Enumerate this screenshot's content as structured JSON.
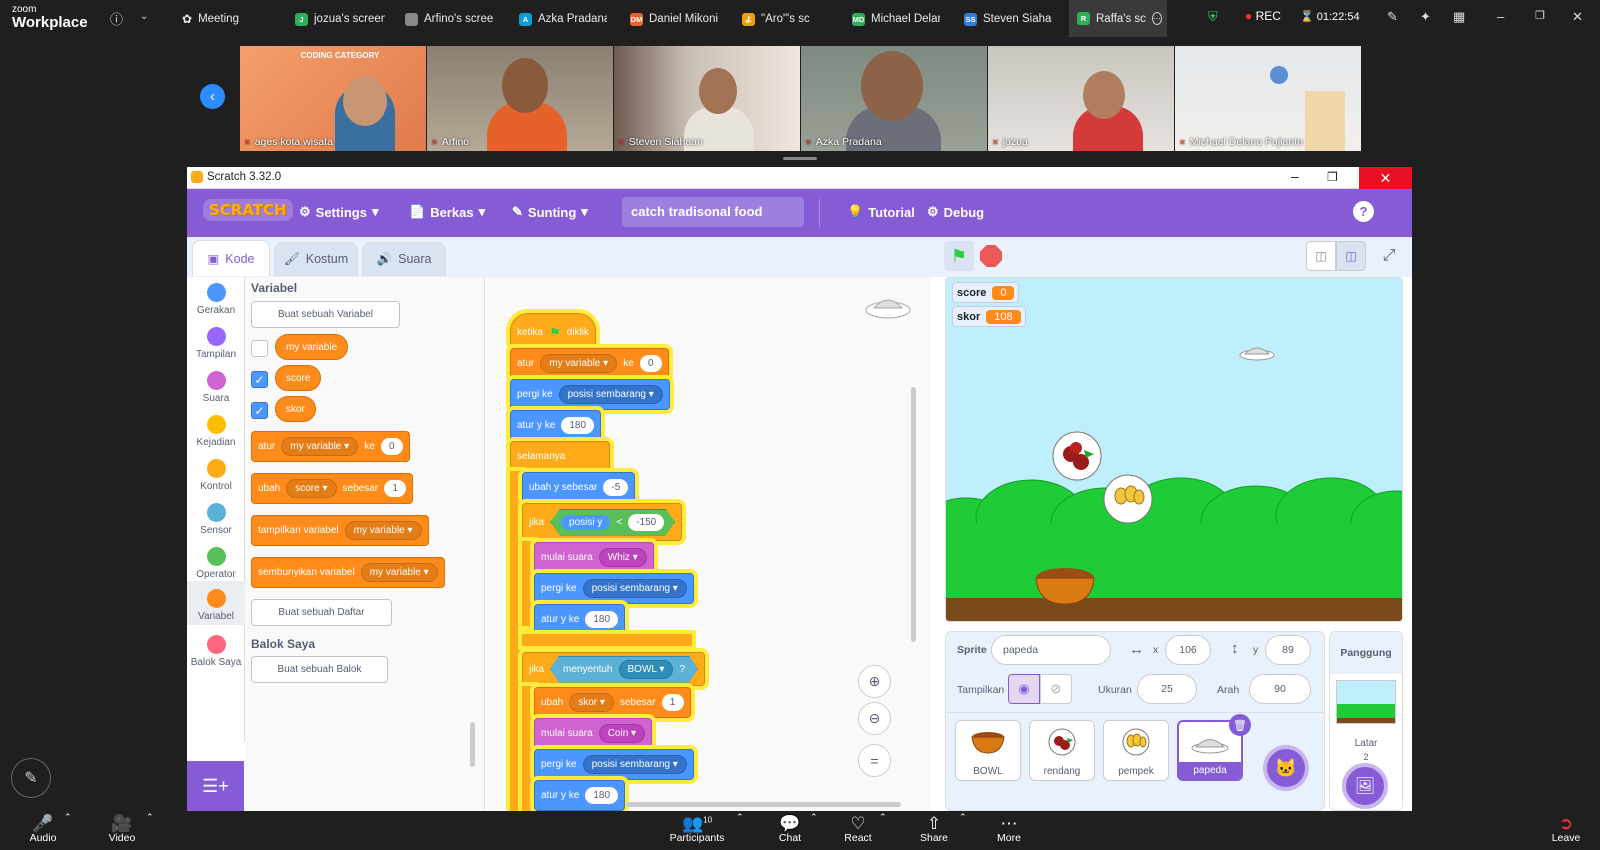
{
  "zoom": {
    "brand_top": "zoom",
    "brand_bottom": "Workplace",
    "tabs": [
      {
        "label": "Meeting",
        "avatar": "",
        "color": ""
      },
      {
        "label": "jozua's screen",
        "avatar": "J",
        "color": "#2eaf5a"
      },
      {
        "label": "Arfino's screen",
        "avatar": "",
        "color": "#888888"
      },
      {
        "label": "Azka Pradana'",
        "avatar": "A",
        "color": "#0f9bd6"
      },
      {
        "label": "Daniel Mikoni",
        "avatar": "DM",
        "color": "#e8642c"
      },
      {
        "label": "\"Aro\"'s sc",
        "avatar": "よ",
        "color": "#e89f12"
      },
      {
        "label": "Michael Delan",
        "avatar": "MD",
        "color": "#2eaf5a"
      },
      {
        "label": "Steven Siahaa",
        "avatar": "SS",
        "color": "#2e7fd6"
      },
      {
        "label": "Raffa's sc",
        "avatar": "R",
        "color": "#2eaf5a"
      }
    ],
    "rec_label": "REC",
    "timer": "01:22:54",
    "participants": [
      {
        "name": "ages kota wisata"
      },
      {
        "name": "Arfino"
      },
      {
        "name": "Steven Siahaan"
      },
      {
        "name": "Azka Pradana"
      },
      {
        "name": "jozua"
      },
      {
        "name": "Michael Delano Pujianto"
      }
    ],
    "thumb_banner": "CODING CATEGORY",
    "toolbar": {
      "audio": "Audio",
      "video": "Video",
      "participants": "Participants",
      "participants_count": "10",
      "chat": "Chat",
      "react": "React",
      "share": "Share",
      "more": "More",
      "leave": "Leave"
    }
  },
  "scratch": {
    "window_title": "Scratch 3.32.0",
    "logo": "SCRATCH",
    "menu": {
      "settings": "Settings",
      "file": "Berkas",
      "edit": "Sunting",
      "project_name": "catch tradisonal food",
      "tutorial": "Tutorial",
      "debug": "Debug"
    },
    "tabs": {
      "code": "Kode",
      "costumes": "Kostum",
      "sounds": "Suara"
    },
    "categories": [
      {
        "label": "Gerakan",
        "color": "#4c97ff"
      },
      {
        "label": "Tampilan",
        "color": "#9966ff"
      },
      {
        "label": "Suara",
        "color": "#cf63cf"
      },
      {
        "label": "Kejadian",
        "color": "#ffbf00"
      },
      {
        "label": "Kontrol",
        "color": "#ffab19"
      },
      {
        "label": "Sensor",
        "color": "#5cb1d6"
      },
      {
        "label": "Operator",
        "color": "#59c059"
      },
      {
        "label": "Variabel",
        "color": "#ff8c1a"
      },
      {
        "label": "Balok Saya",
        "color": "#ff6680"
      }
    ],
    "palette": {
      "heading": "Variabel",
      "make_variable": "Buat sebuah Variabel",
      "variables": [
        {
          "name": "my variable",
          "checked": false
        },
        {
          "name": "score",
          "checked": true
        },
        {
          "name": "skor",
          "checked": true
        }
      ],
      "set_block": {
        "label": "atur",
        "var": "my variable",
        "to": "ke",
        "value": "0"
      },
      "change_block": {
        "label": "ubah",
        "var": "score",
        "by": "sebesar",
        "value": "1"
      },
      "show_block": {
        "label": "tampilkan variabel",
        "var": "my variable"
      },
      "hide_block": {
        "label": "sembunyikan variabel",
        "var": "my variable"
      },
      "make_list": "Buat sebuah Daftar",
      "myblocks_heading": "Balok Saya",
      "make_block": "Buat sebuah Balok"
    },
    "script": {
      "hat": "ketika",
      "hat_suffix": "diklik",
      "set": "atur",
      "set_var": "my variable",
      "set_to": "ke",
      "set_val": "0",
      "goto": "pergi ke",
      "goto_target": "posisi sembarang",
      "sety": "atur y ke",
      "sety_val": "180",
      "forever": "selamanya",
      "changey": "ubah y sebesar",
      "changey_val": "-5",
      "if": "jika",
      "posy": "posisi y",
      "lt": "<",
      "lt_val": "-150",
      "play": "mulai suara",
      "sound1": "Whiz",
      "if2": "jika",
      "touching": "menyentuh",
      "touch_target": "BOWL",
      "q": "?",
      "change": "ubah",
      "change_var": "skor",
      "change_by": "sebesar",
      "change_val": "1",
      "sound2": "Coin"
    },
    "stage": {
      "monitors": [
        {
          "label": "score",
          "value": "0"
        },
        {
          "label": "skor",
          "value": "108"
        }
      ]
    },
    "sprite_info": {
      "sprite_label": "Sprite",
      "sprite_name": "papeda",
      "x_label": "x",
      "x": "106",
      "y_label": "y",
      "y": "89",
      "show_label": "Tampilkan",
      "size_label": "Ukuran",
      "size": "25",
      "direction_label": "Arah",
      "direction": "90"
    },
    "sprites": [
      {
        "name": "BOWL"
      },
      {
        "name": "rendang"
      },
      {
        "name": "pempek"
      },
      {
        "name": "papeda",
        "selected": true
      }
    ],
    "stage_panel": {
      "label": "Panggung",
      "backdrops_label": "Latar",
      "backdrops_count": "2"
    }
  }
}
